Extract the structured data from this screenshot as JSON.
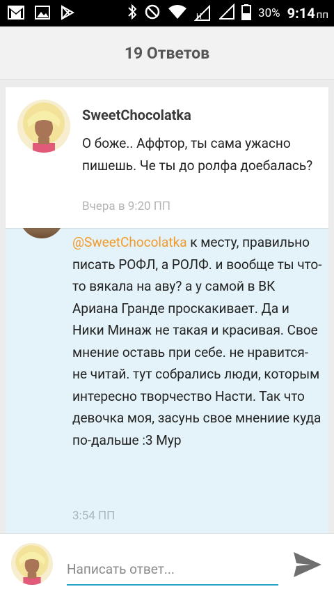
{
  "status_bar": {
    "left_icons": [
      "gmail-icon",
      "image-icon",
      "play-store-icon"
    ],
    "right_icons": [
      "bluetooth-icon",
      "do-not-disturb-icon",
      "wifi-icon",
      "signal-h-icon",
      "signal-icon",
      "battery-icon"
    ],
    "network_type": "H",
    "battery": "30%",
    "time": "9:14",
    "time_suffix": "пп"
  },
  "header": {
    "title": "19 Ответов"
  },
  "comments": [
    {
      "author": "SweetChocolatka",
      "text": "О боже.. Аффтор, ты сама ужасно пишешь. Че ты до ролфа доебалась?",
      "time": "Вчера в 9:20 ПП"
    }
  ],
  "reply": {
    "mention": "@SweetChocolatka",
    "text": " к месту, правильно писать РОФЛ, а РОЛФ. и вообще ты что-то вякала на аву? а у самой в ВК  Ариана Гранде проскакивает.  Да и Ники Минаж не такая и красивая. Свое мнение оставь при себе. не нравится-не читай. тут собрались люди, которым интересно творчество Насти. Так что девочка моя, засунь свое мнениие куда по-дальше :3 Мур",
    "time": "3:54 ПП"
  },
  "input": {
    "placeholder": "Написать ответ..."
  },
  "colors": {
    "accent": "#2a9fc8",
    "mention": "#f39a28",
    "reply_bg": "#e4f3f9"
  }
}
